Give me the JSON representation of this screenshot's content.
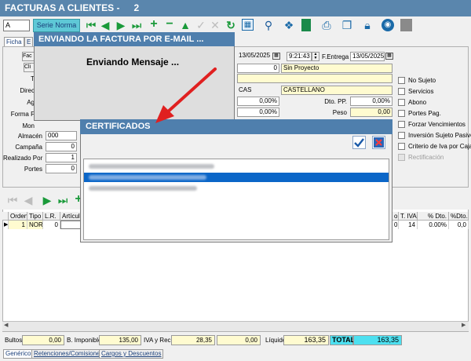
{
  "window": {
    "title": "FACTURAS A CLIENTES -",
    "number": "2"
  },
  "toolbar": {
    "code_value": "A",
    "serie_label": "Serie Norma",
    "icons": [
      "first-icon",
      "prev-icon",
      "next-icon",
      "last-icon",
      "add-icon",
      "delete-icon",
      "up-icon",
      "confirm-icon",
      "cancel-icon",
      "refresh-icon",
      "calculator-icon",
      "search-icon",
      "layers-icon",
      "book-icon",
      "print-icon",
      "copy-icon",
      "lock-icon",
      "help-icon",
      "exit-icon"
    ]
  },
  "tabs": [
    "Ficha",
    "E"
  ],
  "form": {
    "labels": {
      "fac": "Fac",
      "cli": "Cli",
      "t": "T",
      "direc": "Direc",
      "ag": "Ag",
      "forma": "Forma F",
      "mon": "Mon",
      "almacen": "Almacén",
      "campana": "Campaña",
      "realizado": "Realizado Por",
      "portes": "Portes",
      "fentrega": "F.Entrega",
      "dto_pp": "Dto. PP.",
      "peso": "Peso"
    },
    "values": {
      "date1": "13/05/2025",
      "time": "9:21:43",
      "date2": "13/05/2025",
      "proyecto_num": "0",
      "proyecto_name": "Sin Proyecto",
      "idioma_code": "CAS",
      "idioma_name": "CASTELLANO",
      "pct1": "0,00%",
      "dto_pp": "0,00%",
      "pct2": "0,00%",
      "peso": "0,00",
      "almacen": "000",
      "campana": "0",
      "realizado": "1",
      "portes": "0"
    },
    "checks": [
      "No Sujeto",
      "Servicios",
      "Abono",
      "Portes Pag.",
      "Forzar Vencimientos",
      "Inversión Sujeto Pasivo",
      "Criterio de Iva por Caja",
      "Rectificación"
    ]
  },
  "grid": {
    "headers": [
      "Orden",
      "Tipo",
      "L.R.",
      "Artículo",
      "o",
      "T. IVA",
      "% Dto.",
      "%Dto.2"
    ],
    "row": {
      "orden": "1",
      "tipo": "NOR",
      "lr": "0",
      "o": "0",
      "tiva": "14",
      "dto": "0.00%",
      "dto2": "0,0"
    }
  },
  "footer": {
    "bultos_label": "Bultos",
    "bultos": "0,00",
    "base_label": "B. Imponible",
    "base": "135,00",
    "iva_label": "IVA y Rec.",
    "iva": "28,35",
    "rec": "0,00",
    "liquido_label": "Líquido",
    "liquido": "163,35",
    "total_label": "TOTAL",
    "total": "163,35"
  },
  "bottom_tabs": [
    "Genérico",
    "Retenciones/Comisiones",
    "Cargos y Descuentos"
  ],
  "dialog_email": {
    "title": "ENVIANDO LA FACTURA POR E-MAIL ...",
    "message": "Enviando Mensaje  ..."
  },
  "dialog_cert": {
    "title": "CERTIFICADOS",
    "ok_icon": "check-icon",
    "close_icon": "close-icon"
  },
  "colors": {
    "title_bar": "#5a86ad",
    "dialog_title": "#4f7fad",
    "selection": "#0b66c8",
    "total": "#4de0f0",
    "field_yellow": "#fffbd0",
    "arrow": "#e02020"
  }
}
